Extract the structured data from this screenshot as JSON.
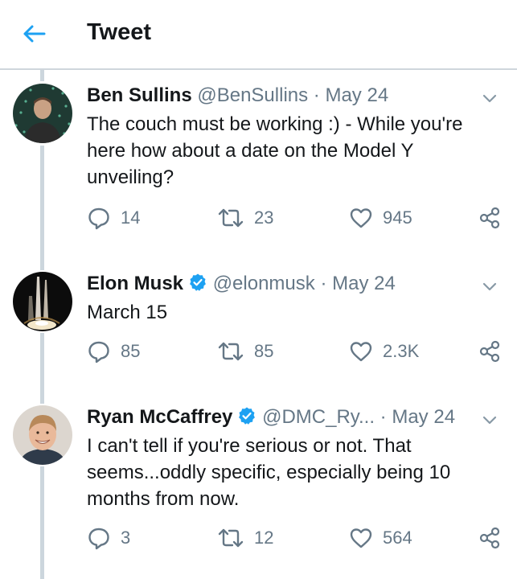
{
  "header": {
    "title": "Tweet"
  },
  "tweets": [
    {
      "name": "Ben Sullins",
      "handle": "@BenSullins",
      "sep": "·",
      "date": "May 24",
      "verified": false,
      "text": "The couch must be working :) - While you're here how about a date on the Model Y unveiling?",
      "replies": "14",
      "retweets": "23",
      "likes": "945"
    },
    {
      "name": "Elon Musk",
      "handle": "@elonmusk",
      "sep": "·",
      "date": "May 24",
      "verified": true,
      "text": "March 15",
      "replies": "85",
      "retweets": "85",
      "likes": "2.3K"
    },
    {
      "name": "Ryan McCaffrey",
      "handle": "@DMC_Ry...",
      "sep": "·",
      "date": "May 24",
      "verified": true,
      "text": "I can't tell if you're serious or not. That seems...oddly specific, especially being 10 months from now.",
      "replies": "3",
      "retweets": "12",
      "likes": "564"
    }
  ],
  "colors": {
    "accent": "#1da1f2",
    "muted": "#657786",
    "text": "#14171a",
    "line": "#ccd6dd"
  },
  "icons": [
    "back-arrow-icon",
    "verified-badge-icon",
    "chevron-down-icon",
    "reply-icon",
    "retweet-icon",
    "like-icon",
    "share-icon"
  ]
}
